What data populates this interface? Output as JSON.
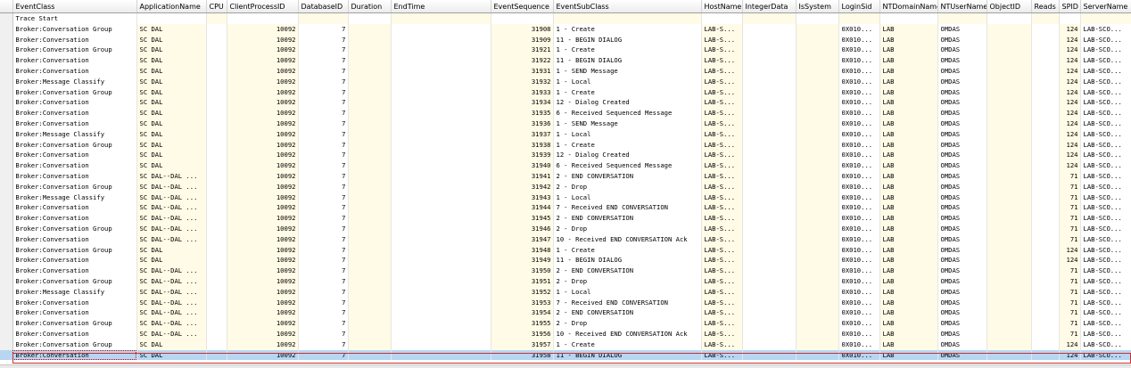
{
  "columns": [
    "EventClass",
    "ApplicationName",
    "CPU",
    "ClientProcessID",
    "DatabaseID",
    "Duration",
    "EndTime",
    "EventSequence",
    "EventSubClass",
    "HostName",
    "IntegerData",
    "IsSystem",
    "LoginSid",
    "NTDomainName",
    "NTUserName",
    "ObjectID",
    "Reads",
    "SPID",
    "ServerName"
  ],
  "first_row": "Trace Start",
  "rows": [
    [
      "Broker:Conversation Group",
      "SC DAL",
      "",
      "10092",
      "7",
      "",
      "",
      "31908",
      "1 - Create",
      "LAB-S...",
      "",
      "",
      "0X010...",
      "LAB",
      "OMDAS",
      "",
      "",
      "124",
      "LAB-SCO..."
    ],
    [
      "Broker:Conversation",
      "SC DAL",
      "",
      "10092",
      "7",
      "",
      "",
      "31909",
      "11 - BEGIN DIALOG",
      "LAB-S...",
      "",
      "",
      "0X010...",
      "LAB",
      "OMDAS",
      "",
      "",
      "124",
      "LAB-SCO..."
    ],
    [
      "Broker:Conversation Group",
      "SC DAL",
      "",
      "10092",
      "7",
      "",
      "",
      "31921",
      "1 - Create",
      "LAB-S...",
      "",
      "",
      "0X010...",
      "LAB",
      "OMDAS",
      "",
      "",
      "124",
      "LAB-SCO..."
    ],
    [
      "Broker:Conversation",
      "SC DAL",
      "",
      "10092",
      "7",
      "",
      "",
      "31922",
      "11 - BEGIN DIALOG",
      "LAB-S...",
      "",
      "",
      "0X010...",
      "LAB",
      "OMDAS",
      "",
      "",
      "124",
      "LAB-SCO..."
    ],
    [
      "Broker:Conversation",
      "SC DAL",
      "",
      "10092",
      "7",
      "",
      "",
      "31931",
      "1 - SEND Message",
      "LAB-S...",
      "",
      "",
      "0X010...",
      "LAB",
      "OMDAS",
      "",
      "",
      "124",
      "LAB-SCO..."
    ],
    [
      "Broker:Message Classify",
      "SC DAL",
      "",
      "10092",
      "7",
      "",
      "",
      "31932",
      "1 - Local",
      "LAB-S...",
      "",
      "",
      "0X010...",
      "LAB",
      "OMDAS",
      "",
      "",
      "124",
      "LAB-SCO..."
    ],
    [
      "Broker:Conversation Group",
      "SC DAL",
      "",
      "10092",
      "7",
      "",
      "",
      "31933",
      "1 - Create",
      "LAB-S...",
      "",
      "",
      "0X010...",
      "LAB",
      "OMDAS",
      "",
      "",
      "124",
      "LAB-SCO..."
    ],
    [
      "Broker:Conversation",
      "SC DAL",
      "",
      "10092",
      "7",
      "",
      "",
      "31934",
      "12 - Dialog Created",
      "LAB-S...",
      "",
      "",
      "0X010...",
      "LAB",
      "OMDAS",
      "",
      "",
      "124",
      "LAB-SCO..."
    ],
    [
      "Broker:Conversation",
      "SC DAL",
      "",
      "10092",
      "7",
      "",
      "",
      "31935",
      "6 - Received Sequenced Message",
      "LAB-S...",
      "",
      "",
      "0X010...",
      "LAB",
      "OMDAS",
      "",
      "",
      "124",
      "LAB-SCO..."
    ],
    [
      "Broker:Conversation",
      "SC DAL",
      "",
      "10092",
      "7",
      "",
      "",
      "31936",
      "1 - SEND Message",
      "LAB-S...",
      "",
      "",
      "0X010...",
      "LAB",
      "OMDAS",
      "",
      "",
      "124",
      "LAB-SCO..."
    ],
    [
      "Broker:Message Classify",
      "SC DAL",
      "",
      "10092",
      "7",
      "",
      "",
      "31937",
      "1 - Local",
      "LAB-S...",
      "",
      "",
      "0X010...",
      "LAB",
      "OMDAS",
      "",
      "",
      "124",
      "LAB-SCO..."
    ],
    [
      "Broker:Conversation Group",
      "SC DAL",
      "",
      "10092",
      "7",
      "",
      "",
      "31938",
      "1 - Create",
      "LAB-S...",
      "",
      "",
      "0X010...",
      "LAB",
      "OMDAS",
      "",
      "",
      "124",
      "LAB-SCO..."
    ],
    [
      "Broker:Conversation",
      "SC DAL",
      "",
      "10092",
      "7",
      "",
      "",
      "31939",
      "12 - Dialog Created",
      "LAB-S...",
      "",
      "",
      "0X010...",
      "LAB",
      "OMDAS",
      "",
      "",
      "124",
      "LAB-SCO..."
    ],
    [
      "Broker:Conversation",
      "SC DAL",
      "",
      "10092",
      "7",
      "",
      "",
      "31940",
      "6 - Received Sequenced Message",
      "LAB-S...",
      "",
      "",
      "0X010...",
      "LAB",
      "OMDAS",
      "",
      "",
      "124",
      "LAB-SCO..."
    ],
    [
      "Broker:Conversation",
      "SC DAL--DAL ...",
      "",
      "10092",
      "7",
      "",
      "",
      "31941",
      "2 - END CONVERSATION",
      "LAB-S...",
      "",
      "",
      "0X010...",
      "LAB",
      "OMDAS",
      "",
      "",
      "71",
      "LAB-SCO..."
    ],
    [
      "Broker:Conversation Group",
      "SC DAL--DAL ...",
      "",
      "10092",
      "7",
      "",
      "",
      "31942",
      "2 - Drop",
      "LAB-S...",
      "",
      "",
      "0X010...",
      "LAB",
      "OMDAS",
      "",
      "",
      "71",
      "LAB-SCO..."
    ],
    [
      "Broker:Message Classify",
      "SC DAL--DAL ...",
      "",
      "10092",
      "7",
      "",
      "",
      "31943",
      "1 - Local",
      "LAB-S...",
      "",
      "",
      "0X010...",
      "LAB",
      "OMDAS",
      "",
      "",
      "71",
      "LAB-SCO..."
    ],
    [
      "Broker:Conversation",
      "SC DAL--DAL ...",
      "",
      "10092",
      "7",
      "",
      "",
      "31944",
      "7 - Received END CONVERSATION",
      "LAB-S...",
      "",
      "",
      "0X010...",
      "LAB",
      "OMDAS",
      "",
      "",
      "71",
      "LAB-SCO..."
    ],
    [
      "Broker:Conversation",
      "SC DAL--DAL ...",
      "",
      "10092",
      "7",
      "",
      "",
      "31945",
      "2 - END CONVERSATION",
      "LAB-S...",
      "",
      "",
      "0X010...",
      "LAB",
      "OMDAS",
      "",
      "",
      "71",
      "LAB-SCO..."
    ],
    [
      "Broker:Conversation Group",
      "SC DAL--DAL ...",
      "",
      "10092",
      "7",
      "",
      "",
      "31946",
      "2 - Drop",
      "LAB-S...",
      "",
      "",
      "0X010...",
      "LAB",
      "OMDAS",
      "",
      "",
      "71",
      "LAB-SCO..."
    ],
    [
      "Broker:Conversation",
      "SC DAL--DAL ...",
      "",
      "10092",
      "7",
      "",
      "",
      "31947",
      "10 - Received END CONVERSATION Ack",
      "LAB-S...",
      "",
      "",
      "0X010...",
      "LAB",
      "OMDAS",
      "",
      "",
      "71",
      "LAB-SCO..."
    ],
    [
      "Broker:Conversation Group",
      "SC DAL",
      "",
      "10092",
      "7",
      "",
      "",
      "31948",
      "1 - Create",
      "LAB-S...",
      "",
      "",
      "0X010...",
      "LAB",
      "OMDAS",
      "",
      "",
      "124",
      "LAB-SCO..."
    ],
    [
      "Broker:Conversation",
      "SC DAL",
      "",
      "10092",
      "7",
      "",
      "",
      "31949",
      "11 - BEGIN DIALOG",
      "LAB-S...",
      "",
      "",
      "0X010...",
      "LAB",
      "OMDAS",
      "",
      "",
      "124",
      "LAB-SCO..."
    ],
    [
      "Broker:Conversation",
      "SC DAL--DAL ...",
      "",
      "10092",
      "7",
      "",
      "",
      "31950",
      "2 - END CONVERSATION",
      "LAB-S...",
      "",
      "",
      "0X010...",
      "LAB",
      "OMDAS",
      "",
      "",
      "71",
      "LAB-SCO..."
    ],
    [
      "Broker:Conversation Group",
      "SC DAL--DAL ...",
      "",
      "10092",
      "7",
      "",
      "",
      "31951",
      "2 - Drop",
      "LAB-S...",
      "",
      "",
      "0X010...",
      "LAB",
      "OMDAS",
      "",
      "",
      "71",
      "LAB-SCO..."
    ],
    [
      "Broker:Message Classify",
      "SC DAL--DAL ...",
      "",
      "10092",
      "7",
      "",
      "",
      "31952",
      "1 - Local",
      "LAB-S...",
      "",
      "",
      "0X010...",
      "LAB",
      "OMDAS",
      "",
      "",
      "71",
      "LAB-SCO..."
    ],
    [
      "Broker:Conversation",
      "SC DAL--DAL ...",
      "",
      "10092",
      "7",
      "",
      "",
      "31953",
      "7 - Received END CONVERSATION",
      "LAB-S...",
      "",
      "",
      "0X010...",
      "LAB",
      "OMDAS",
      "",
      "",
      "71",
      "LAB-SCO..."
    ],
    [
      "Broker:Conversation",
      "SC DAL--DAL ...",
      "",
      "10092",
      "7",
      "",
      "",
      "31954",
      "2 - END CONVERSATION",
      "LAB-S...",
      "",
      "",
      "0X010...",
      "LAB",
      "OMDAS",
      "",
      "",
      "71",
      "LAB-SCO..."
    ],
    [
      "Broker:Conversation Group",
      "SC DAL--DAL ...",
      "",
      "10092",
      "7",
      "",
      "",
      "31955",
      "2 - Drop",
      "LAB-S...",
      "",
      "",
      "0X010...",
      "LAB",
      "OMDAS",
      "",
      "",
      "71",
      "LAB-SCO..."
    ],
    [
      "Broker:Conversation",
      "SC DAL--DAL ...",
      "",
      "10092",
      "7",
      "",
      "",
      "31956",
      "10 - Received END CONVERSATION Ack",
      "LAB-S...",
      "",
      "",
      "0X010...",
      "LAB",
      "OMDAS",
      "",
      "",
      "71",
      "LAB-SCO..."
    ],
    [
      "Broker:Conversation Group",
      "SC DAL",
      "",
      "10092",
      "7",
      "",
      "",
      "31957",
      "1 - Create",
      "LAB-S...",
      "",
      "",
      "0X010...",
      "LAB",
      "OMDAS",
      "",
      "",
      "124",
      "LAB-SCO..."
    ],
    [
      "Broker:Conversation",
      "SC DAL",
      "",
      "10092",
      "7",
      "",
      "",
      "31958",
      "11 - BEGIN DIALOG",
      "LAB-S...",
      "",
      "",
      "0X010...",
      "LAB",
      "OMDAS",
      "",
      "",
      "124",
      "LAB-SCO..."
    ]
  ],
  "selected_row_index": 31,
  "colors": {
    "selection": "#b8d6f2",
    "alt_column": "#fffbe6",
    "header": "#ececec",
    "selection_border": "#c83232"
  }
}
